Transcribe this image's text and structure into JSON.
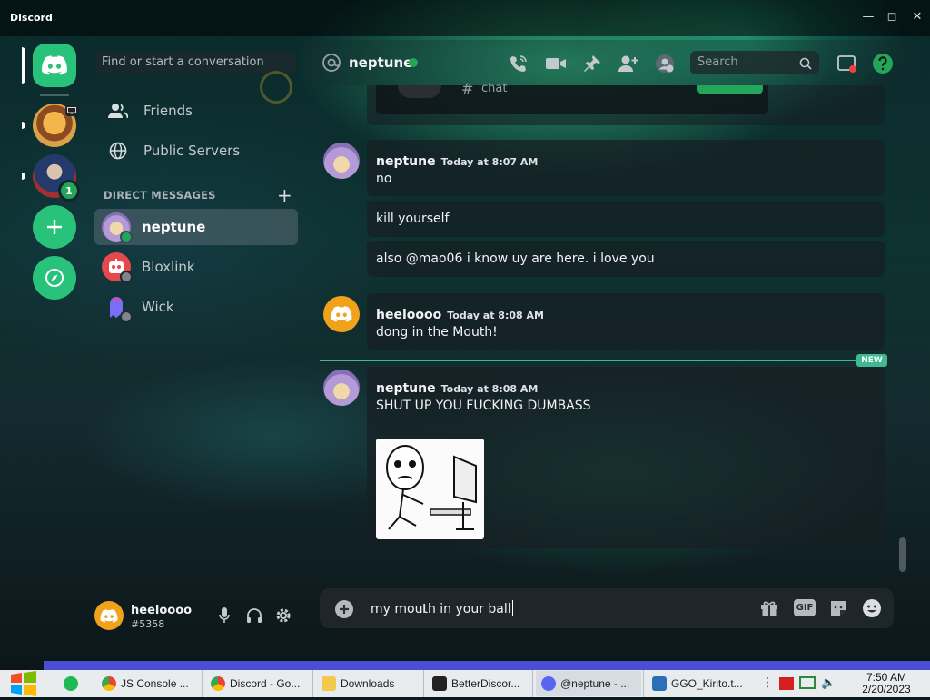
{
  "window": {
    "app_title": "Discord",
    "controls": [
      "minimize",
      "maximize",
      "close"
    ]
  },
  "sidebar": {
    "search_placeholder": "Find or start a conversation",
    "friends_label": "Friends",
    "public_servers_label": "Public Servers",
    "dm_header": "DIRECT MESSAGES",
    "dm_add": "+",
    "dms": [
      {
        "name": "neptune",
        "status": "online",
        "active": true
      },
      {
        "name": "Bloxlink",
        "status": "offline",
        "active": false
      },
      {
        "name": "Wick",
        "status": "offline",
        "active": false
      }
    ],
    "server_badge": "1"
  },
  "user_panel": {
    "username": "heeloooo",
    "tag": "#5358"
  },
  "header": {
    "channel_name": "neptune",
    "search_placeholder": "Search"
  },
  "embed_preview": {
    "text": "chat"
  },
  "messages": [
    {
      "author": "neptune",
      "time": "Today at 8:07 AM",
      "lines": [
        "no",
        "kill yourself",
        "also @mao06 i know uy are here. i love you"
      ]
    },
    {
      "author": "heeloooo",
      "time": "Today at 8:08 AM",
      "lines": [
        "dong in the Mouth!"
      ]
    },
    {
      "author": "neptune",
      "time": "Today at 8:08 AM",
      "lines": [
        "SHUT UP YOU FUCKING DUMBASS"
      ],
      "has_image": true
    }
  ],
  "new_badge": "NEW",
  "composer": {
    "value": "my mouth in your ball",
    "gif_label": "GIF"
  },
  "taskbar": {
    "items": [
      {
        "label": "JS Console ..."
      },
      {
        "label": "Discord - Go..."
      },
      {
        "label": "Downloads"
      },
      {
        "label": "BetterDiscor..."
      },
      {
        "label": "@neptune - ..."
      },
      {
        "label": "GGO_Kirito.t..."
      }
    ],
    "time": "7:50 AM",
    "date": "2/20/2023"
  },
  "colors": {
    "discord_green": "#23a55a",
    "brand_teal": "#3fb98f",
    "rail_button": "#29c27a"
  }
}
